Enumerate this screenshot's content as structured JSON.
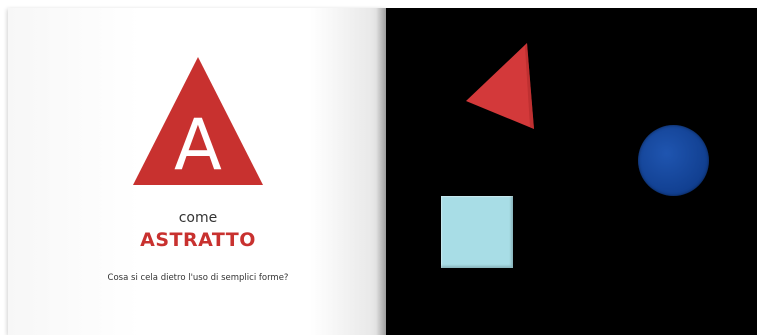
{
  "letter": "A",
  "left_page": {
    "connector": "come",
    "word": "ASTRATTO",
    "question": "Cosa si cela dietro l'uso di semplici forme?"
  },
  "colors": {
    "accent_red": "#c8312f",
    "shape_red": "#d3393a",
    "shape_blue": "#1b4ea6",
    "shape_light_blue": "#a8dde6",
    "right_page_background": "#000000"
  },
  "right_page": {
    "shapes": [
      "red-triangle",
      "blue-circle",
      "light-blue-square"
    ]
  }
}
